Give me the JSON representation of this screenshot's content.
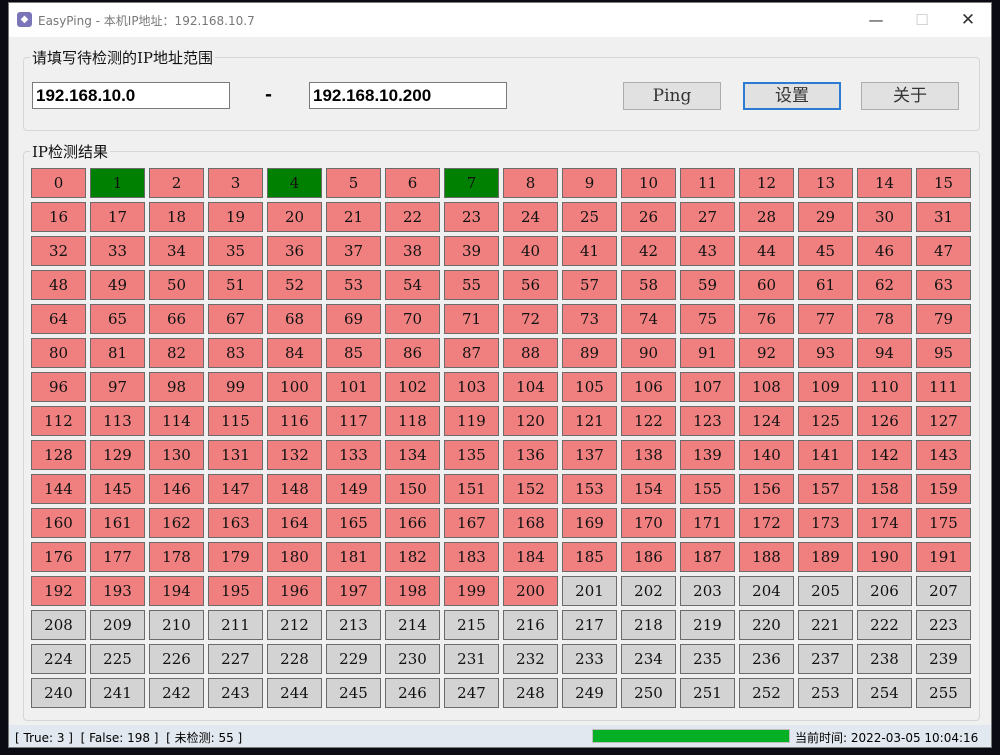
{
  "window": {
    "title": "EasyPing - 本机IP地址：192.168.10.7",
    "minimize": "—",
    "maximize": "☐",
    "close": "✕"
  },
  "range": {
    "legend": "请填写待检测的IP地址范围",
    "start_ip": "192.168.10.0",
    "separator": "-",
    "end_ip": "192.168.10.200"
  },
  "buttons": {
    "ping": "Ping",
    "settings": "设置",
    "about": "关于"
  },
  "results": {
    "legend": "IP检测结果",
    "colors": {
      "true": "#008000",
      "false": "#f08080",
      "unchecked": "#d3d3d3"
    },
    "true_hosts": [
      1,
      4,
      7
    ],
    "checked_max": 200,
    "total": 256
  },
  "status": {
    "counts": "[ True: 3 ]  [ False: 198 ]  [ 未检测: 55 ]",
    "progress": 1.0,
    "time_label": "当前时间:  2022-03-05 10:04:16"
  }
}
